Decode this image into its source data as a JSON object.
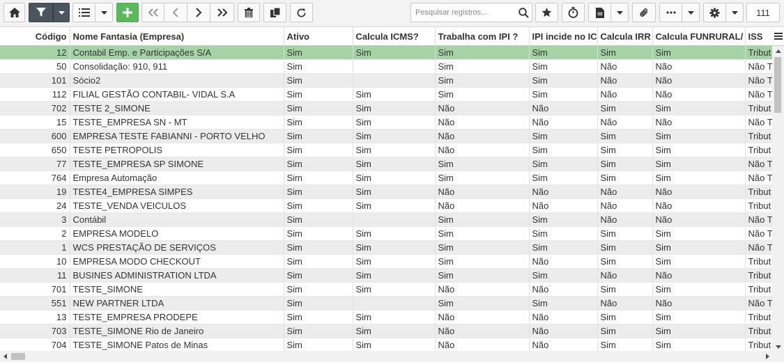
{
  "toolbar": {
    "search_placeholder": "Pesquisar registros...",
    "record_count": "111"
  },
  "table": {
    "columns": [
      "Código",
      "Nome Fantasia (Empresa)",
      "Ativo",
      "Calcula ICMS?",
      "Trabalha com IPI ?",
      "IPI incide no IC",
      "Calcula IRR",
      "Calcula FUNRURAL/",
      "ISS"
    ],
    "rows": [
      [
        "12",
        "Contabil Emp. e Participações S/A",
        "Sim",
        "Sim",
        "Sim",
        "Sim",
        "Sim",
        "Sim",
        "Tribut"
      ],
      [
        "50",
        "Consolidação: 910, 911",
        "Sim",
        "",
        "Sim",
        "Sim",
        "Não",
        "Não",
        "Não T"
      ],
      [
        "101",
        "Sócio2",
        "Sim",
        "",
        "Sim",
        "Sim",
        "Não",
        "Não",
        "Não T"
      ],
      [
        "112",
        "FILIAL GESTÃO CONTABIL- VIDAL S.A",
        "Sim",
        "Sim",
        "Sim",
        "Sim",
        "Não",
        "Não",
        "Não T"
      ],
      [
        "702",
        "TESTE 2_SIMONE",
        "Sim",
        "Sim",
        "Não",
        "Não",
        "Sim",
        "Sim",
        "Tribut"
      ],
      [
        "15",
        "TESTE_EMPRESA SN - MT",
        "Sim",
        "Sim",
        "Não",
        "Não",
        "Não",
        "Não",
        "Não T"
      ],
      [
        "600",
        "EMPRESA TESTE FABIANNI - PORTO VELHO",
        "Sim",
        "Sim",
        "Não",
        "Sim",
        "Sim",
        "Sim",
        "Tribut"
      ],
      [
        "650",
        "TESTE PETROPOLIS",
        "Sim",
        "Sim",
        "Não",
        "Sim",
        "Sim",
        "Sim",
        "Tribut"
      ],
      [
        "77",
        "TESTE_EMPRESA SP SIMONE",
        "Sim",
        "Sim",
        "Sim",
        "Sim",
        "Sim",
        "Sim",
        "Não T"
      ],
      [
        "764",
        "Empresa Automação",
        "Sim",
        "Sim",
        "Sim",
        "Sim",
        "Sim",
        "Sim",
        "Não T"
      ],
      [
        "19",
        "TESTE4_EMPRESA SIMPES",
        "Sim",
        "Sim",
        "Não",
        "Não",
        "Não",
        "Não",
        "Tribut"
      ],
      [
        "24",
        "TESTE_VENDA VEICULOS",
        "Sim",
        "Sim",
        "Não",
        "Não",
        "Não",
        "Não",
        "Tribut"
      ],
      [
        "3",
        "Contábil",
        "Sim",
        "",
        "Sim",
        "Sim",
        "Não",
        "Não",
        "Não T"
      ],
      [
        "2",
        "EMPRESA MODELO",
        "Sim",
        "Sim",
        "Sim",
        "Sim",
        "Sim",
        "Sim",
        "Não T"
      ],
      [
        "1",
        "WCS PRESTAÇÃO DE SERVIÇOS",
        "Sim",
        "Sim",
        "Sim",
        "Sim",
        "Sim",
        "Sim",
        "Não T"
      ],
      [
        "10",
        "EMPRESA MODO CHECKOUT",
        "Sim",
        "Sim",
        "Sim",
        "Não",
        "Sim",
        "Sim",
        "Tribut"
      ],
      [
        "11",
        "BUSINES ADMINISTRATION LTDA",
        "Sim",
        "Sim",
        "Sim",
        "Sim",
        "Não",
        "Não",
        "Tribut"
      ],
      [
        "701",
        "TESTE_SIMONE",
        "Sim",
        "Sim",
        "Não",
        "Não",
        "Sim",
        "Sim",
        "Tribut"
      ],
      [
        "551",
        "NEW PARTNER LTDA",
        "Sim",
        "",
        "Sim",
        "Sim",
        "Não",
        "Não",
        "Não T"
      ],
      [
        "13",
        "TESTE_EMPRESA PRODEPE",
        "Sim",
        "Sim",
        "Não",
        "Não",
        "Sim",
        "Sim",
        "Tribut"
      ],
      [
        "703",
        "TESTE_SIMONE Rio de Janeiro",
        "Sim",
        "Sim",
        "Não",
        "Não",
        "Sim",
        "Sim",
        "Tribut"
      ],
      [
        "704",
        "TESTE_SIMONE Patos de Minas",
        "Sim",
        "Sim",
        "Não",
        "Não",
        "Sim",
        "Sim",
        "Tribut"
      ]
    ]
  },
  "colors": {
    "selected_row": "#a6d3a6",
    "add_button": "#5cb85c",
    "filter_button": "#4a5560"
  }
}
